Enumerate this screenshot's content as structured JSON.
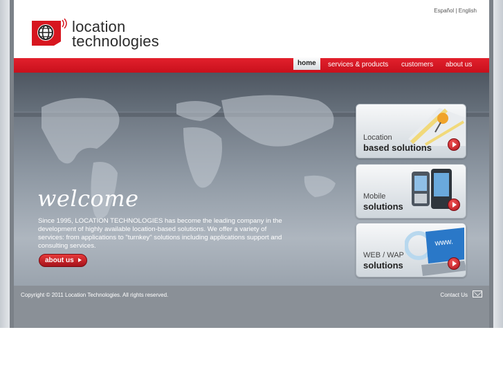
{
  "header": {
    "languages": [
      "Español",
      "English"
    ],
    "lang_separator": "|",
    "logo_line1": "location",
    "logo_line2": "technologies"
  },
  "nav": {
    "items": [
      {
        "label": "home",
        "active": true
      },
      {
        "label": "services & products",
        "active": false
      },
      {
        "label": "customers",
        "active": false
      },
      {
        "label": "about us",
        "active": false
      }
    ]
  },
  "hero": {
    "heading": "welcome",
    "intro": "Since 1995, LOCATION TECHNOLOGIES has become the leading company in the development of highly available location-based solutions. We offer a variety of services: from applications to \"turnkey\" solutions including applications support and consulting services.",
    "about_button": "about us"
  },
  "tiles": [
    {
      "line1": "Location",
      "line2": "based solutions",
      "icon": "map-pin-icon"
    },
    {
      "line1": "Mobile",
      "line2": "solutions",
      "icon": "mobile-phone-icon"
    },
    {
      "line1": "WEB / WAP",
      "line2": "solutions",
      "icon": "laptop-icon",
      "screen_text": "www."
    }
  ],
  "footer": {
    "copyright": "Copyright © 2011 Location Technologies. All rights reserved.",
    "contact": "Contact Us"
  },
  "colors": {
    "brand_red": "#d7161f",
    "frame_gray": "#8a9097"
  }
}
